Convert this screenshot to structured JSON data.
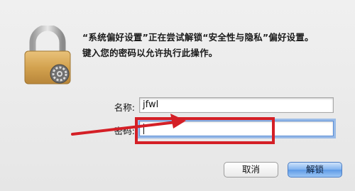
{
  "dialog": {
    "message_line1": "“系统偏好设置”正在尝试解锁“安全性与隐私”偏好设置。",
    "message_line2": "键入您的密码以允许执行此操作。",
    "username_label": "名称:",
    "username_value": "jfwl",
    "password_label": "密码:",
    "password_value": "",
    "cancel_label": "取消",
    "unlock_label": "解锁",
    "lock_icon": "padlock-with-gear-icon"
  },
  "annotation": {
    "arrow_color": "#d41f26",
    "box_color": "#d41f26"
  }
}
